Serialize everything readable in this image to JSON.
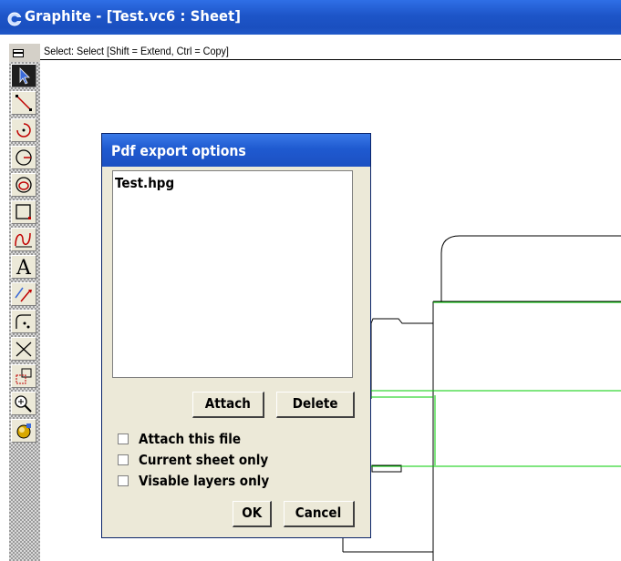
{
  "window": {
    "title": "Graphite - [Test.vc6 : Sheet]"
  },
  "status": {
    "prompt": "Select: Select  [Shift = Extend, Ctrl = Copy]"
  },
  "toolbar": {
    "tools": [
      {
        "name": "select-arrow-icon",
        "selected": true
      },
      {
        "name": "line-tool-icon"
      },
      {
        "name": "arc-tool-icon"
      },
      {
        "name": "circle-tool-icon"
      },
      {
        "name": "ellipse-tool-icon"
      },
      {
        "name": "rectangle-tool-icon"
      },
      {
        "name": "spline-tool-icon"
      },
      {
        "name": "text-tool-icon"
      },
      {
        "name": "dimension-tool-icon"
      },
      {
        "name": "fillet-tool-icon"
      },
      {
        "name": "trim-tool-icon"
      },
      {
        "name": "symbol-tool-icon"
      },
      {
        "name": "zoom-tool-icon"
      },
      {
        "name": "plugin-tool-icon"
      }
    ]
  },
  "dialog": {
    "title": "Pdf export options",
    "files": [
      "Test.hpg"
    ],
    "attach_label": "Attach",
    "delete_label": "Delete",
    "checkboxes": [
      {
        "label": "Attach this file",
        "checked": false
      },
      {
        "label": "Current sheet only",
        "checked": false
      },
      {
        "label": "Visable layers only",
        "checked": false
      }
    ],
    "ok_label": "OK",
    "cancel_label": "Cancel"
  },
  "colors": {
    "title_bar": "#1d55c8",
    "dialog_face": "#ece9d8",
    "green_lines": "#00cc00"
  }
}
